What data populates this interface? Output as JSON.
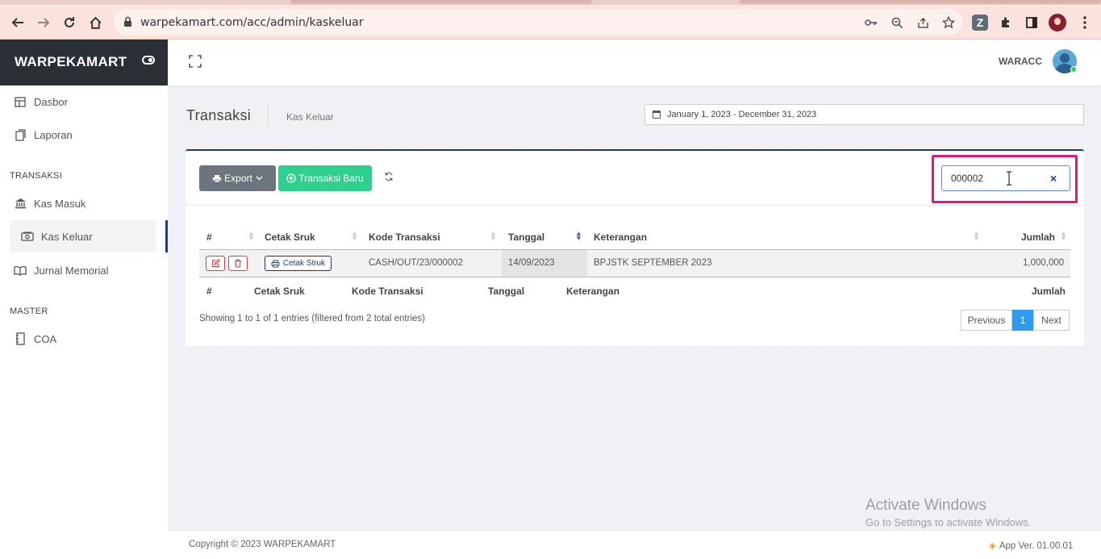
{
  "browser": {
    "url": "warpekamart.com/acc/admin/kaskeluar"
  },
  "sidebar": {
    "brand": "WARPEKAMART",
    "items_top": [
      {
        "label": "Dasbor",
        "icon": "dashboard-icon"
      },
      {
        "label": "Laporan",
        "icon": "report-icon"
      }
    ],
    "section_transaksi": "TRANSAKSI",
    "items_transaksi": [
      {
        "label": "Kas Masuk",
        "icon": "bank-icon"
      },
      {
        "label": "Kas Keluar",
        "icon": "money-icon"
      },
      {
        "label": "Jurnal Memorial",
        "icon": "book-icon"
      }
    ],
    "section_master": "MASTER",
    "items_master": [
      {
        "label": "COA",
        "icon": "notebook-icon"
      }
    ]
  },
  "header": {
    "user": "WARACC"
  },
  "page": {
    "title": "Transaksi",
    "subtitle": "Kas Keluar",
    "daterange": "January 1, 2023 - December 31, 2023"
  },
  "toolbar": {
    "export_label": "Export",
    "new_label": "Transaksi Baru",
    "search_value": "000002"
  },
  "table": {
    "columns": [
      "#",
      "Cetak Sruk",
      "Kode Transaksi",
      "Tanggal",
      "Keterangan",
      "Jumlah"
    ],
    "rows": [
      {
        "print_label": "Cetak Struk",
        "kode": "CASH/OUT/23/000002",
        "tanggal": "14/09/2023",
        "keterangan": "BPJSTK SEPTEMBER 2023",
        "jumlah": "1,000,000"
      }
    ],
    "info": "Showing 1 to 1 of 1 entries (filtered from 2 total entries)",
    "pagination": {
      "previous": "Previous",
      "current": "1",
      "next": "Next"
    }
  },
  "footer": {
    "copyright": "Copyright © 2023 WARPEKAMART",
    "version": "App Ver. 01.00.01"
  },
  "watermark": {
    "line1": "Activate Windows",
    "line2": "Go to Settings to activate Windows."
  }
}
